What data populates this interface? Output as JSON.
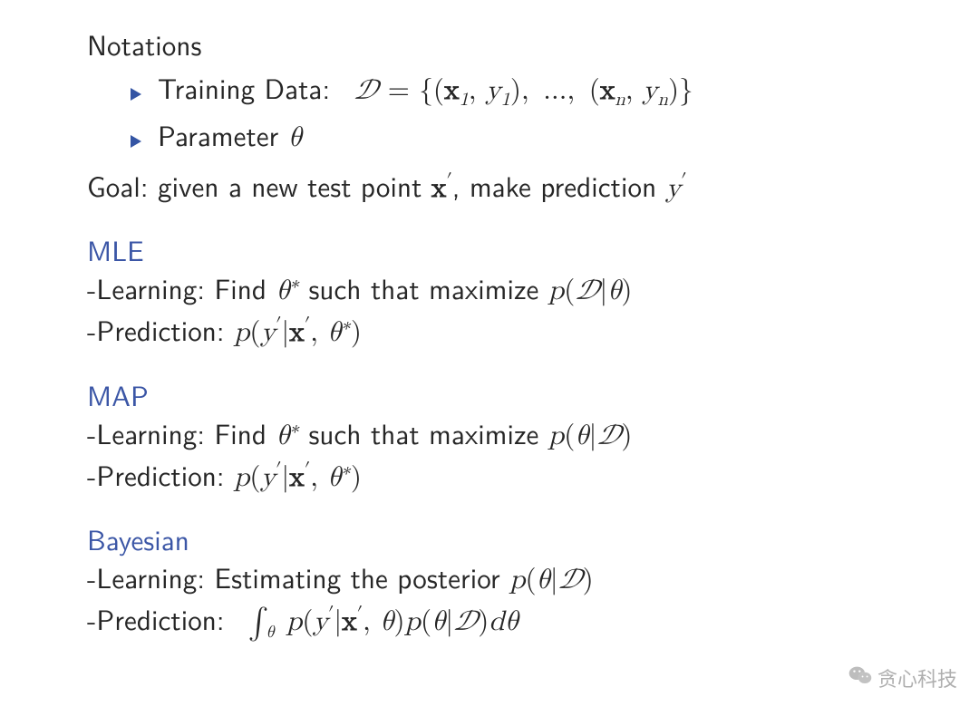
{
  "notations": {
    "heading": "Notations",
    "items": [
      "Training Data: 𝒟 = {(𝐱₁, y₁), ..., (𝐱ₙ, yₙ)}",
      "Parameter θ"
    ]
  },
  "goal": "Goal: given a new test point 𝐱′, make prediction y′",
  "methods": [
    {
      "name": "MLE",
      "learning": "-Learning: Find θ* such that maximize p(𝒟|θ)",
      "prediction": "-Prediction: p(y′|𝐱′, θ*)"
    },
    {
      "name": "MAP",
      "learning": "-Learning: Find θ* such that maximize p(θ|𝒟)",
      "prediction": "-Prediction: p(y′|𝐱′, θ*)"
    },
    {
      "name": "Bayesian",
      "learning": "-Learning: Estimating the posterior p(θ|𝒟)",
      "prediction": "-Prediction: ∫θ p(y′|𝐱′, θ)p(θ|𝒟)dθ"
    }
  ],
  "watermark": {
    "icon": "wechat-icon",
    "text": "贪心科技"
  }
}
